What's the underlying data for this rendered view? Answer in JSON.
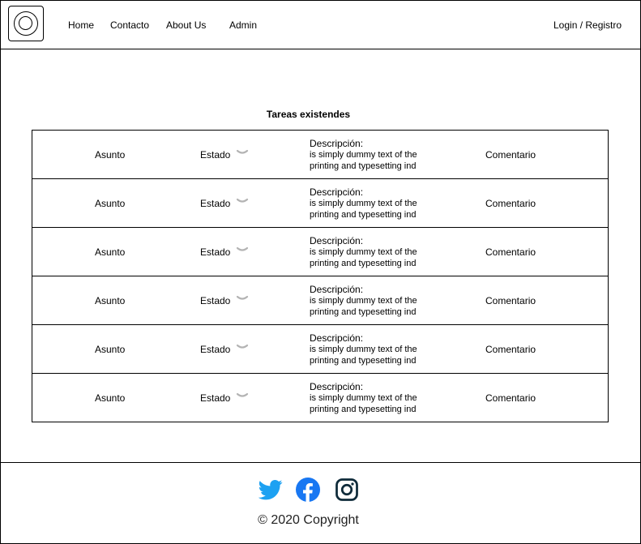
{
  "nav": {
    "home": "Home",
    "contacto": "Contacto",
    "about": "About Us",
    "admin": "Admin",
    "login": "Login / Registro"
  },
  "main": {
    "title": "Tareas existendes",
    "rows": [
      {
        "asunto": "Asunto",
        "estado": "Estado",
        "desc_label": "Descripción:",
        "desc_line1": "is simply dummy text of the",
        "desc_line2": "printing and typesetting ind",
        "comentario": "Comentario"
      },
      {
        "asunto": "Asunto",
        "estado": "Estado",
        "desc_label": "Descripción:",
        "desc_line1": "is simply dummy text of the",
        "desc_line2": "printing and typesetting ind",
        "comentario": "Comentario"
      },
      {
        "asunto": "Asunto",
        "estado": "Estado",
        "desc_label": "Descripción:",
        "desc_line1": "is simply dummy text of the",
        "desc_line2": "printing and typesetting ind",
        "comentario": "Comentario"
      },
      {
        "asunto": "Asunto",
        "estado": "Estado",
        "desc_label": "Descripción:",
        "desc_line1": "is simply dummy text of the",
        "desc_line2": "printing and typesetting ind",
        "comentario": "Comentario"
      },
      {
        "asunto": "Asunto",
        "estado": "Estado",
        "desc_label": "Descripción:",
        "desc_line1": "is simply dummy text of the",
        "desc_line2": "printing and typesetting ind",
        "comentario": "Comentario"
      },
      {
        "asunto": "Asunto",
        "estado": "Estado",
        "desc_label": "Descripción:",
        "desc_line1": "is simply dummy text of the",
        "desc_line2": "printing and typesetting ind",
        "comentario": "Comentario"
      }
    ]
  },
  "footer": {
    "copyright": "© 2020 Copyright",
    "icons": [
      "twitter-icon",
      "facebook-icon",
      "instagram-icon"
    ],
    "colors": {
      "twitter": "#1DA1F2",
      "facebook": "#1877F2",
      "instagram": "#0F2B3A"
    }
  },
  "colors": {
    "border": "#000000",
    "chevron": "#B3B3B3"
  }
}
